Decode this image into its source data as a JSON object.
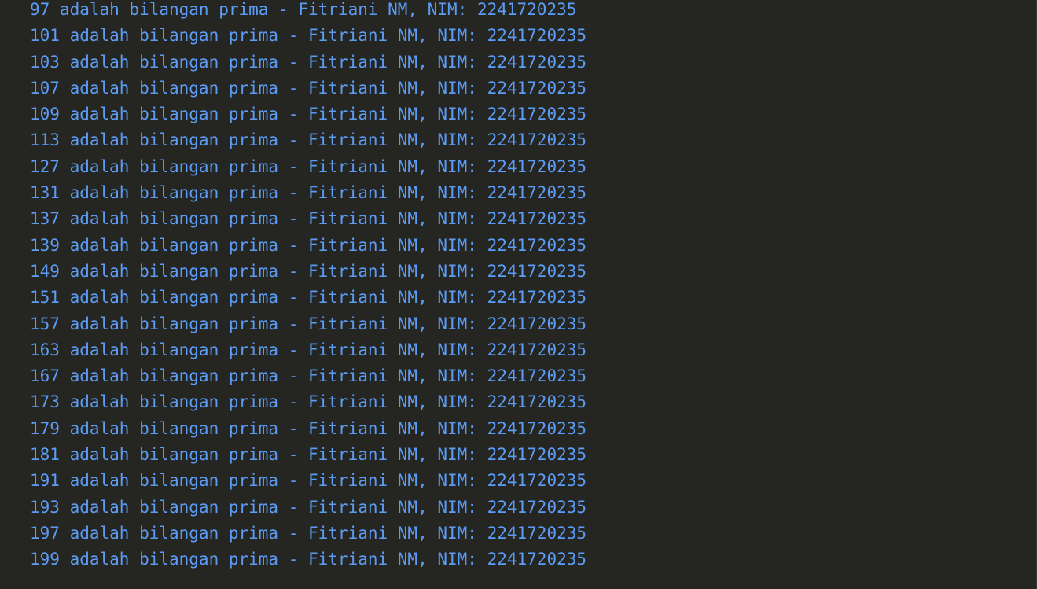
{
  "terminal": {
    "lines": [
      "97 adalah bilangan prima - Fitriani NM, NIM: 2241720235",
      "101 adalah bilangan prima - Fitriani NM, NIM: 2241720235",
      "103 adalah bilangan prima - Fitriani NM, NIM: 2241720235",
      "107 adalah bilangan prima - Fitriani NM, NIM: 2241720235",
      "109 adalah bilangan prima - Fitriani NM, NIM: 2241720235",
      "113 adalah bilangan prima - Fitriani NM, NIM: 2241720235",
      "127 adalah bilangan prima - Fitriani NM, NIM: 2241720235",
      "131 adalah bilangan prima - Fitriani NM, NIM: 2241720235",
      "137 adalah bilangan prima - Fitriani NM, NIM: 2241720235",
      "139 adalah bilangan prima - Fitriani NM, NIM: 2241720235",
      "149 adalah bilangan prima - Fitriani NM, NIM: 2241720235",
      "151 adalah bilangan prima - Fitriani NM, NIM: 2241720235",
      "157 adalah bilangan prima - Fitriani NM, NIM: 2241720235",
      "163 adalah bilangan prima - Fitriani NM, NIM: 2241720235",
      "167 adalah bilangan prima - Fitriani NM, NIM: 2241720235",
      "173 adalah bilangan prima - Fitriani NM, NIM: 2241720235",
      "179 adalah bilangan prima - Fitriani NM, NIM: 2241720235",
      "181 adalah bilangan prima - Fitriani NM, NIM: 2241720235",
      "191 adalah bilangan prima - Fitriani NM, NIM: 2241720235",
      "193 adalah bilangan prima - Fitriani NM, NIM: 2241720235",
      "197 adalah bilangan prima - Fitriani NM, NIM: 2241720235",
      "199 adalah bilangan prima - Fitriani NM, NIM: 2241720235"
    ]
  },
  "colors": {
    "background": "#252622",
    "text": "#5c9cf5"
  }
}
